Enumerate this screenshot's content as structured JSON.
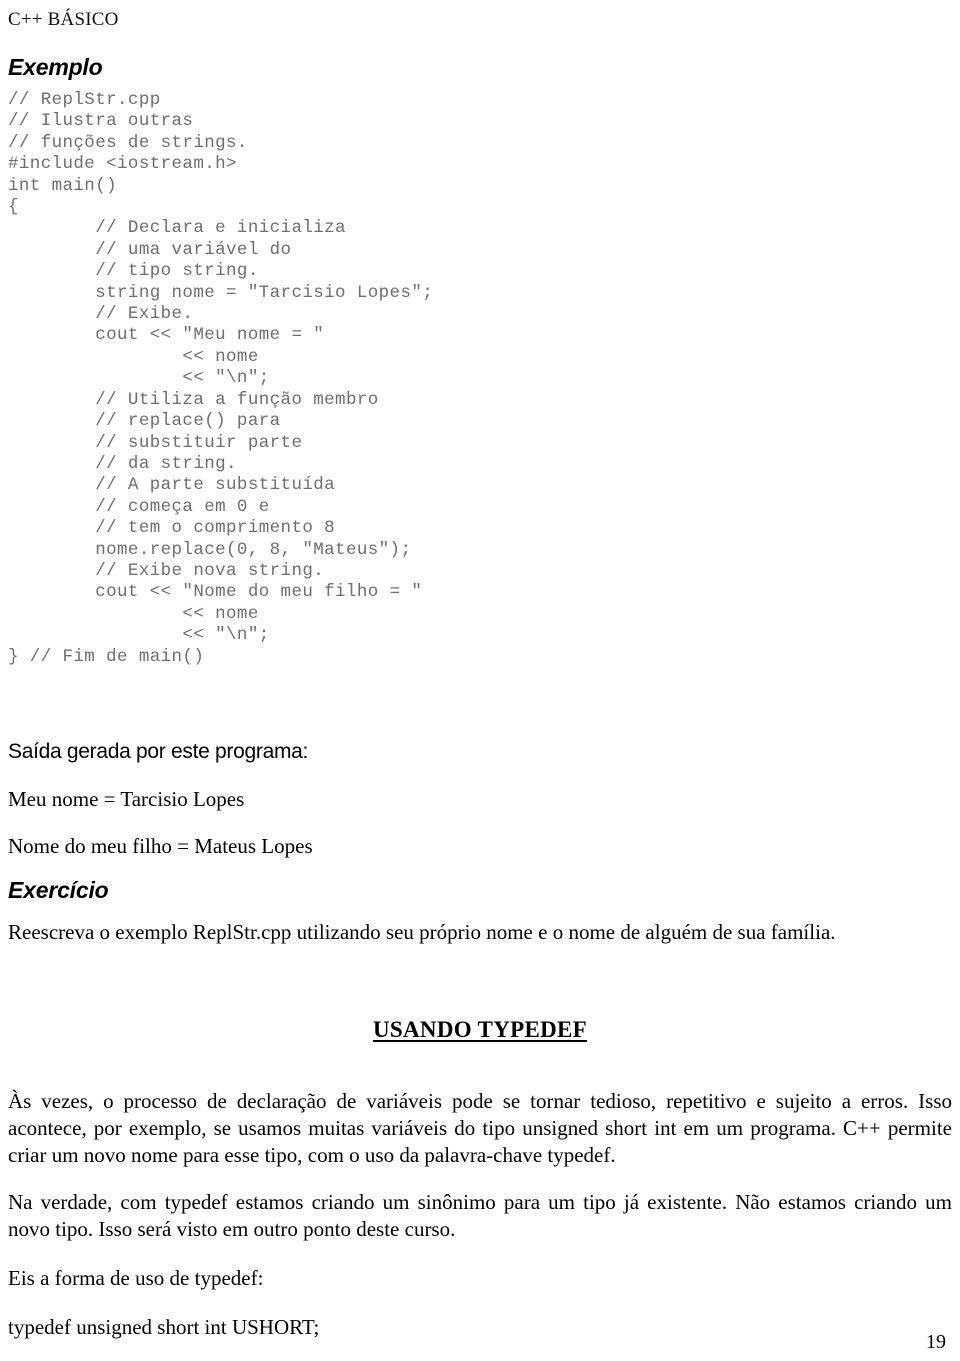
{
  "document": {
    "running_header": "C++ BÁSICO",
    "page_number": "19"
  },
  "sections": {
    "exemplo_heading": "Exemplo",
    "saida_heading": "Saída gerada por este programa:",
    "exercicio_heading": "Exercício",
    "typedef_heading": "USANDO TYPEDEF"
  },
  "code": {
    "lines": [
      "// ReplStr.cpp",
      "// Ilustra outras",
      "// funções de strings.",
      "#include <iostream.h>",
      "int main()",
      "{",
      "        // Declara e inicializa",
      "        // uma variável do",
      "        // tipo string.",
      "        string nome = \"Tarcisio Lopes\";",
      "        // Exibe.",
      "        cout << \"Meu nome = \"",
      "                << nome",
      "                << \"\\n\";",
      "        // Utiliza a função membro",
      "        // replace() para",
      "        // substituir parte",
      "        // da string.",
      "        // A parte substituída",
      "        // começa em 0 e",
      "        // tem o comprimento 8",
      "        nome.replace(0, 8, \"Mateus\");",
      "        // Exibe nova string.",
      "        cout << \"Nome do meu filho = \"",
      "                << nome",
      "                << \"\\n\";",
      "} // Fim de main()"
    ]
  },
  "program_output": {
    "line1": "Meu nome = Tarcisio Lopes",
    "line2": "Nome do meu filho = Mateus Lopes"
  },
  "exercise": {
    "text": "Reescreva o exemplo ReplStr.cpp utilizando seu próprio nome e o nome de alguém de sua família."
  },
  "typedef_section": {
    "paragraph1": "Às vezes, o processo de declaração de variáveis pode se tornar tedioso, repetitivo e sujeito a erros. Isso acontece, por exemplo, se usamos muitas variáveis do tipo unsigned short int em um programa. C++ permite criar um novo nome para esse tipo, com o uso da palavra-chave typedef.",
    "paragraph2": "Na verdade, com typedef estamos criando um sinônimo para um tipo já existente. Não estamos criando um novo tipo. Isso será visto em outro ponto deste curso.",
    "paragraph3": "Eis a forma de uso de typedef:",
    "code_sample": "typedef unsigned short int USHORT;"
  }
}
